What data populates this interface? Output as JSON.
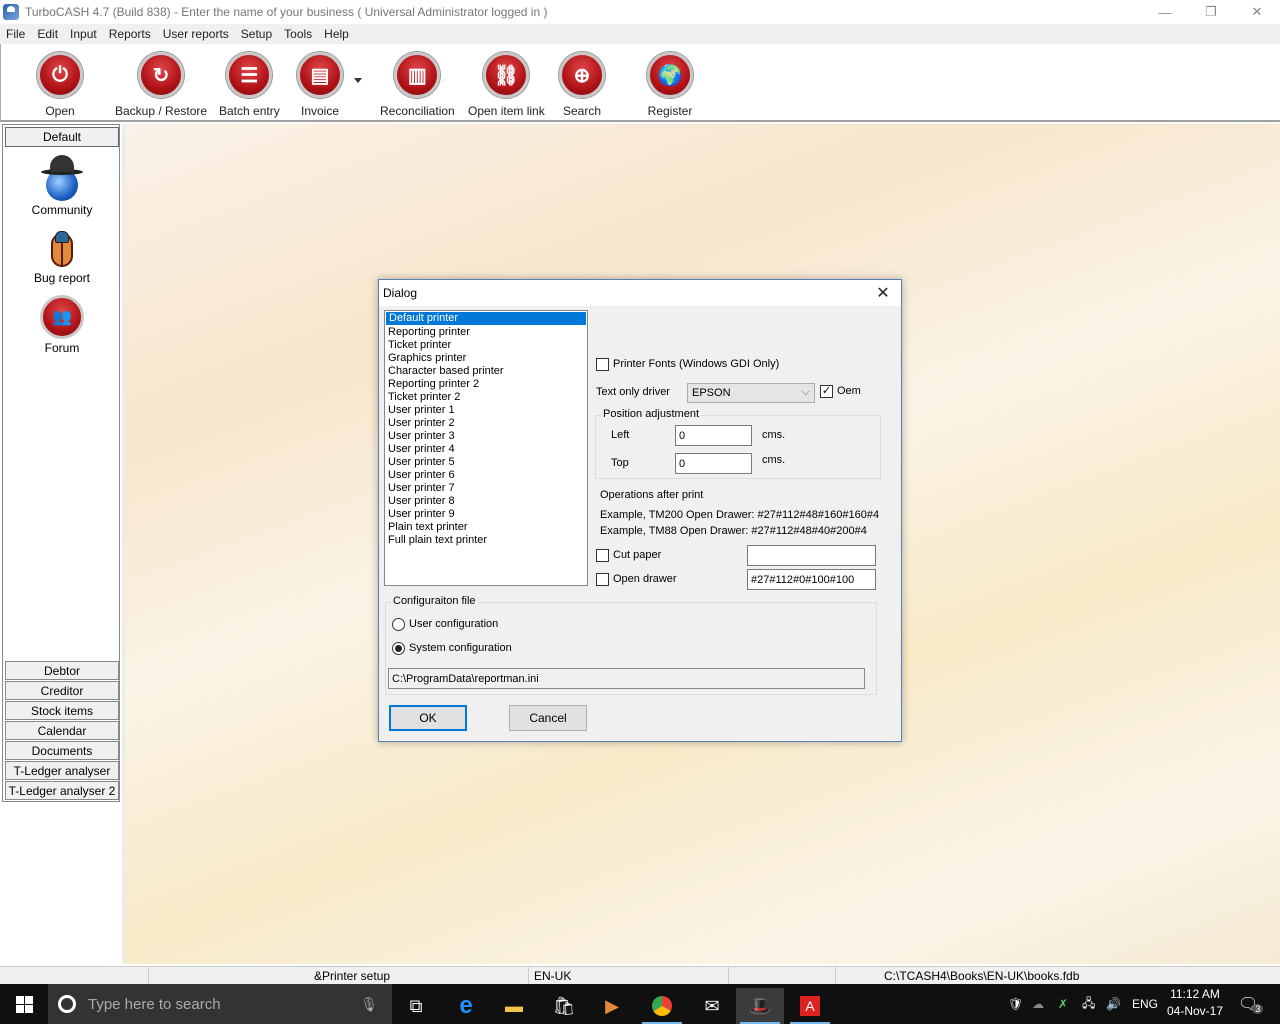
{
  "window": {
    "title": "TurboCASH 4.7 (Build 838)  - Enter the name of your business ( Universal Administrator logged in )",
    "controls": {
      "minimize": "—",
      "restore": "❐",
      "close": "✕"
    }
  },
  "menu": [
    "File",
    "Edit",
    "Input",
    "Reports",
    "User reports",
    "Setup",
    "Tools",
    "Help"
  ],
  "toolbar": [
    {
      "label": "Open",
      "icon": "power-icon",
      "glyph": "⏻"
    },
    {
      "label": "Backup / Restore",
      "icon": "backup-icon",
      "glyph": "↻"
    },
    {
      "label": "Batch entry",
      "icon": "batch-icon",
      "glyph": "☰"
    },
    {
      "label": "Invoice",
      "icon": "invoice-icon",
      "glyph": "▤"
    },
    {
      "label": "Reconciliation",
      "icon": "trash-icon",
      "glyph": "▥"
    },
    {
      "label": "Open item link",
      "icon": "link-icon",
      "glyph": "⛓"
    },
    {
      "label": "Search",
      "icon": "search-icon",
      "glyph": "⊕"
    },
    {
      "label": "Register",
      "icon": "globe-icon",
      "glyph": "🌍"
    }
  ],
  "sidebar": {
    "header": "Default",
    "items": [
      {
        "label": "Community",
        "icon": "community-icon"
      },
      {
        "label": "Bug report",
        "icon": "bug-icon"
      },
      {
        "label": "Forum",
        "icon": "forum-icon"
      }
    ],
    "sections": [
      "Debtor",
      "Creditor",
      "Stock items",
      "Calendar",
      "Documents",
      "T-Ledger analyser",
      "T-Ledger analyser 2"
    ]
  },
  "dialog": {
    "title": "Dialog",
    "printers": [
      "Default printer",
      "Reporting printer",
      "Ticket printer",
      "Graphics printer",
      "Character based printer",
      "Reporting printer 2",
      "Ticket printer 2",
      "User printer 1",
      "User printer 2",
      "User printer 3",
      "User printer 4",
      "User printer 5",
      "User printer 6",
      "User printer 7",
      "User printer 8",
      "User printer 9",
      "Plain text printer",
      "Full plain text printer"
    ],
    "selected_printer": "Default printer",
    "printer_fonts_label": "Printer Fonts (Windows GDI Only)",
    "printer_fonts_checked": false,
    "text_only_driver_label": "Text only driver",
    "text_only_driver_value": "EPSON",
    "oem_label": "Oem",
    "oem_checked": true,
    "position_adjustment": {
      "title": "Position adjustment",
      "left_label": "Left",
      "left_value": "0",
      "top_label": "Top",
      "top_value": "0",
      "unit": "cms."
    },
    "operations_title": "Operations after print",
    "example1": "Example, TM200 Open Drawer: #27#112#48#160#160#4",
    "example2": "Example, TM88 Open Drawer: #27#112#48#40#200#4",
    "cut_paper_label": "Cut paper",
    "cut_paper_checked": false,
    "cut_paper_value": "",
    "open_drawer_label": "Open drawer",
    "open_drawer_checked": false,
    "open_drawer_value": "#27#112#0#100#100",
    "config": {
      "title": "Configuraiton file",
      "user_label": "User configuration",
      "system_label": "System configuration",
      "selected": "System configuration",
      "path": "C:\\ProgramData\\reportman.ini"
    },
    "ok_label": "OK",
    "cancel_label": "Cancel"
  },
  "statusbar": {
    "action": "&Printer setup",
    "language": "EN-UK",
    "database": "C:\\TCASH4\\Books\\EN-UK\\books.fdb"
  },
  "taskbar": {
    "search_placeholder": "Type here to search",
    "language": "ENG",
    "time": "11:12 AM",
    "date": "04-Nov-17",
    "notifications": "3"
  }
}
